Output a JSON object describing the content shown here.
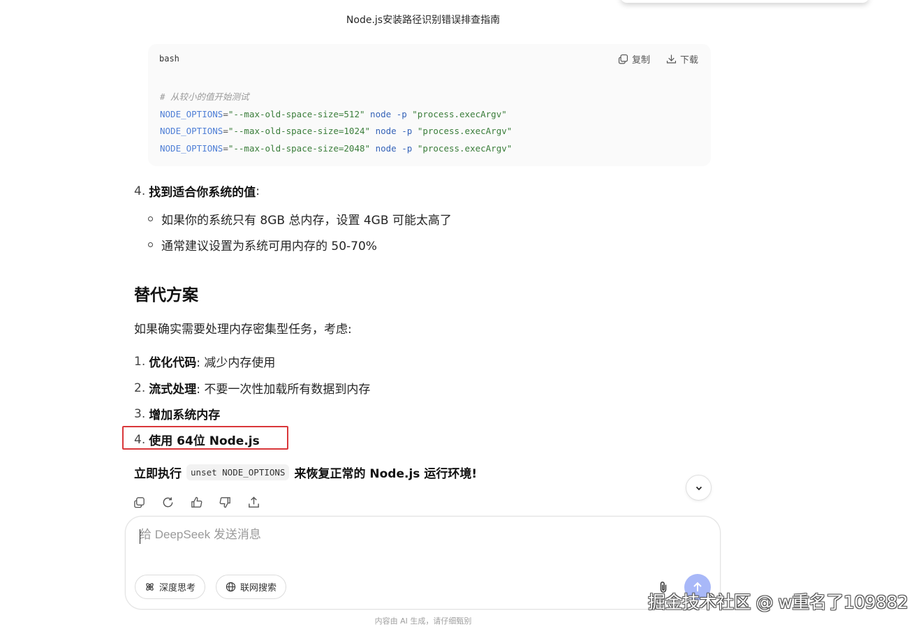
{
  "header": {
    "title": "Node.js安装路径识别错误排查指南"
  },
  "code_block": {
    "language": "bash",
    "copy_label": "复制",
    "download_label": "下载",
    "comment": "# 从较小的值开始测试",
    "lines": [
      {
        "var": "NODE_OPTIONS",
        "value": "\"--max-old-space-size=512\"",
        "cmd": "node",
        "flag": "-p",
        "arg": "\"process.execArgv\""
      },
      {
        "var": "NODE_OPTIONS",
        "value": "\"--max-old-space-size=1024\"",
        "cmd": "node",
        "flag": "-p",
        "arg": "\"process.execArgv\""
      },
      {
        "var": "NODE_OPTIONS",
        "value": "\"--max-old-space-size=2048\"",
        "cmd": "node",
        "flag": "-p",
        "arg": "\"process.execArgv\""
      }
    ]
  },
  "step4": {
    "num": "4.",
    "title": "找到适合你系统的值",
    "suffix": ":",
    "bullets": [
      "如果你的系统只有 8GB 总内存，设置 4GB 可能太高了",
      "通常建议设置为系统可用内存的 50-70%"
    ]
  },
  "alternatives": {
    "heading": "替代方案",
    "intro": "如果确实需要处理内存密集型任务，考虑:",
    "items": [
      {
        "num": "1.",
        "bold": "优化代码",
        "rest": ": 减少内存使用"
      },
      {
        "num": "2.",
        "bold": "流式处理",
        "rest": ": 不要一次性加载所有数据到内存"
      },
      {
        "num": "3.",
        "bold": "增加系统内存",
        "rest": ""
      },
      {
        "num": "4.",
        "bold": "使用 64位 Node.js",
        "rest": ""
      }
    ]
  },
  "final": {
    "before": "立即执行",
    "code": "unset NODE_OPTIONS",
    "after": "来恢复正常的 Node.js 运行环境!"
  },
  "composer": {
    "placeholder": "给 DeepSeek 发送消息",
    "deep_think_label": "深度思考",
    "web_search_label": "联网搜索"
  },
  "disclaimer": "内容由 AI 生成，请仔细甄别",
  "watermark": "掘金技术社区 @ w重名了109882",
  "colors": {
    "accent_send": "#a8b8f8",
    "highlight_border": "#d9373a"
  }
}
